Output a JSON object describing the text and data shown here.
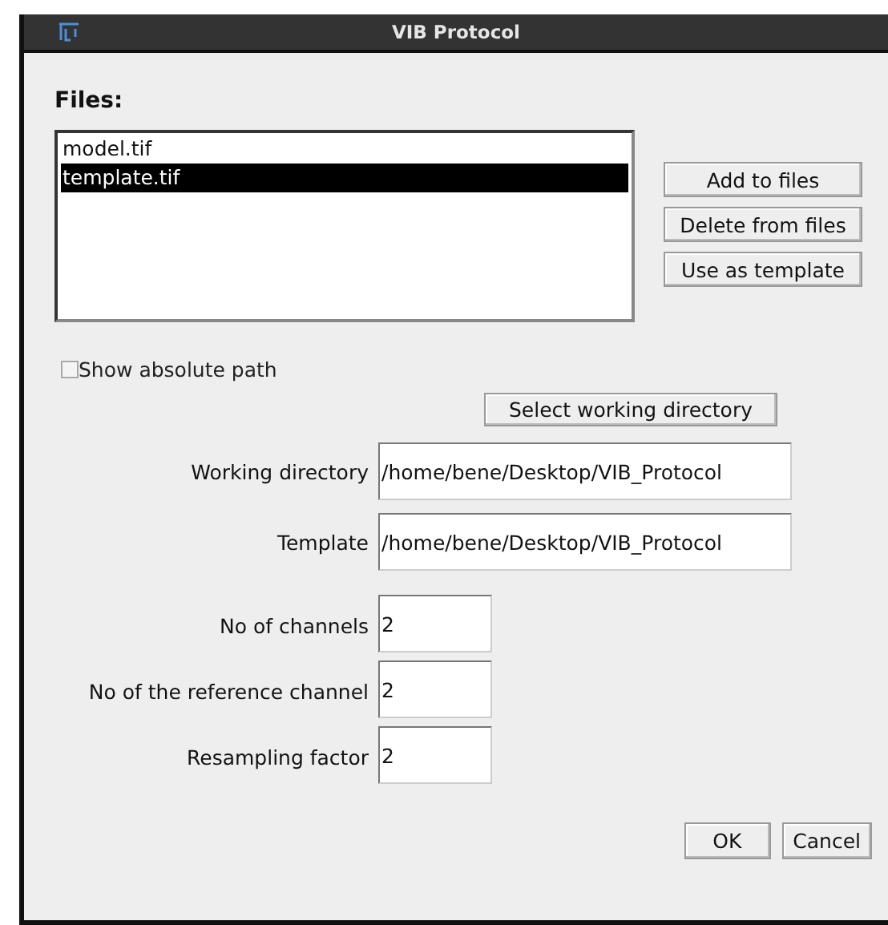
{
  "window": {
    "title": "VIB Protocol"
  },
  "files_heading": "Files:",
  "files": [
    {
      "name": "model.tif",
      "selected": false
    },
    {
      "name": "template.tif",
      "selected": true
    }
  ],
  "file_buttons": [
    "Add to files",
    "Delete from files",
    "Use as template"
  ],
  "show_absolute_path": {
    "label": "Show absolute path",
    "checked": false
  },
  "select_dir_button": "Select working directory",
  "path_fields": [
    {
      "label": "Working directory",
      "value": "/home/bene/Desktop/VIB_Protocol"
    },
    {
      "label": "Template",
      "value": "/home/bene/Desktop/VIB_Protocol"
    }
  ],
  "number_fields": [
    {
      "label": "No of channels",
      "value": "2"
    },
    {
      "label": "No of the reference channel",
      "value": "2"
    },
    {
      "label": "Resampling factor",
      "value": "2"
    }
  ],
  "buttons": [
    "OK",
    "Cancel"
  ]
}
